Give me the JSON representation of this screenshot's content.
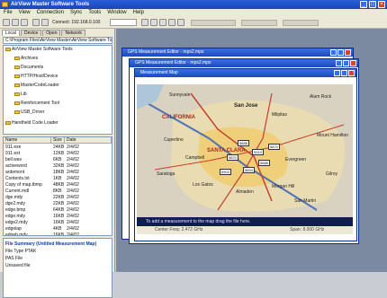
{
  "app": {
    "title": "AirView Master Software Tools"
  },
  "menu": [
    "File",
    "View",
    "Connection",
    "Sync",
    "Tools",
    "Window",
    "Help"
  ],
  "toolbar": {
    "connect_label": "Connect: 192.168.0.100"
  },
  "left": {
    "tabs": [
      "Local",
      "Device",
      "Open",
      "Network"
    ],
    "path": "C:\\Program Files\\AirView Master\\AirView Software Tools",
    "tree": [
      {
        "label": "AirView Master Software Tools",
        "indent": 0
      },
      {
        "label": "Archives",
        "indent": 1
      },
      {
        "label": "Documents",
        "indent": 1
      },
      {
        "label": "HTTP/Host/Device",
        "indent": 1
      },
      {
        "label": "MasterCodeLoader",
        "indent": 1
      },
      {
        "label": "Lib",
        "indent": 1
      },
      {
        "label": "Reinforcement Tool",
        "indent": 1
      },
      {
        "label": "USB_Driver",
        "indent": 1
      },
      {
        "label": "Handheld Code Loader",
        "indent": 0
      }
    ],
    "list_headers": [
      "Name",
      "Size",
      "Date"
    ],
    "files": [
      {
        "name": "911.exe",
        "size": "24KB",
        "date": "2/4/02"
      },
      {
        "name": "911 ext",
        "size": "12KB",
        "date": "2/4/02"
      },
      {
        "name": "bell.wav",
        "size": "6KB",
        "date": "2/4/02"
      },
      {
        "name": "activeword",
        "size": "32KB",
        "date": "2/4/02"
      },
      {
        "name": "ardemont",
        "size": "18KB",
        "date": "2/4/02"
      },
      {
        "name": "Contents.txt",
        "size": "1KB",
        "date": "2/4/02"
      },
      {
        "name": "Copy of map.tbmp",
        "size": "48KB",
        "date": "2/4/02"
      },
      {
        "name": "Current.mdl",
        "size": "8KB",
        "date": "2/4/02"
      },
      {
        "name": "dge.mdy",
        "size": "22KB",
        "date": "2/4/02"
      },
      {
        "name": "dge2.mdy",
        "size": "22KB",
        "date": "2/4/02"
      },
      {
        "name": "edge.bmp",
        "size": "64KB",
        "date": "2/4/02"
      },
      {
        "name": "edge.mdy",
        "size": "16KB",
        "date": "2/4/02"
      },
      {
        "name": "edge2.mdy",
        "size": "16KB",
        "date": "2/4/02"
      },
      {
        "name": "edgelap",
        "size": "4KB",
        "date": "2/4/02"
      },
      {
        "name": "edgeb.mdy",
        "size": "16KB",
        "date": "2/4/02"
      }
    ],
    "summary": {
      "title": "File Summary (Untitled Measurement Map)",
      "rows": [
        "File Type   PTAK",
        "PAS File",
        "Unsaved file"
      ]
    }
  },
  "windows": {
    "back_title": "GPS Measurement Editor - mps2.mps",
    "mid_title": "GPS Measurement Editor - mps2.mps",
    "map_title": "Measurement Map"
  },
  "map": {
    "labels": {
      "san_jose": "San Jose",
      "santa_clara": "SANTA CLARA",
      "california": "CALIFORNIA",
      "milpitas": "Milpitas",
      "san_martin": "San Martin",
      "campbell": "Campbell",
      "cupertino": "Cupertino",
      "los_gatos": "Los Gatos",
      "saratoga": "Saratoga",
      "alum_rock": "Alum Rock",
      "sunnyvale": "Sunnyvale",
      "hollister": "Morgan Hill",
      "morgan": "Almaden",
      "evergreen": "Evergreen",
      "mount_ham": "Mount Hamilton",
      "gilroy": "Gilroy"
    },
    "markers": [
      "5888",
      "5870",
      "5919",
      "5888",
      "5894",
      "6903",
      "5870"
    ],
    "colors": {
      "land": "#d9d2c0",
      "urban": "#efcf7a",
      "roads": "#c2412f",
      "highway": "#4f72b8"
    }
  },
  "status": {
    "hint": "To add a measurement to the map drag the file here.",
    "left": "Center Freq: 2.472 GHz",
    "right": "Span: 8.000 GHz"
  }
}
